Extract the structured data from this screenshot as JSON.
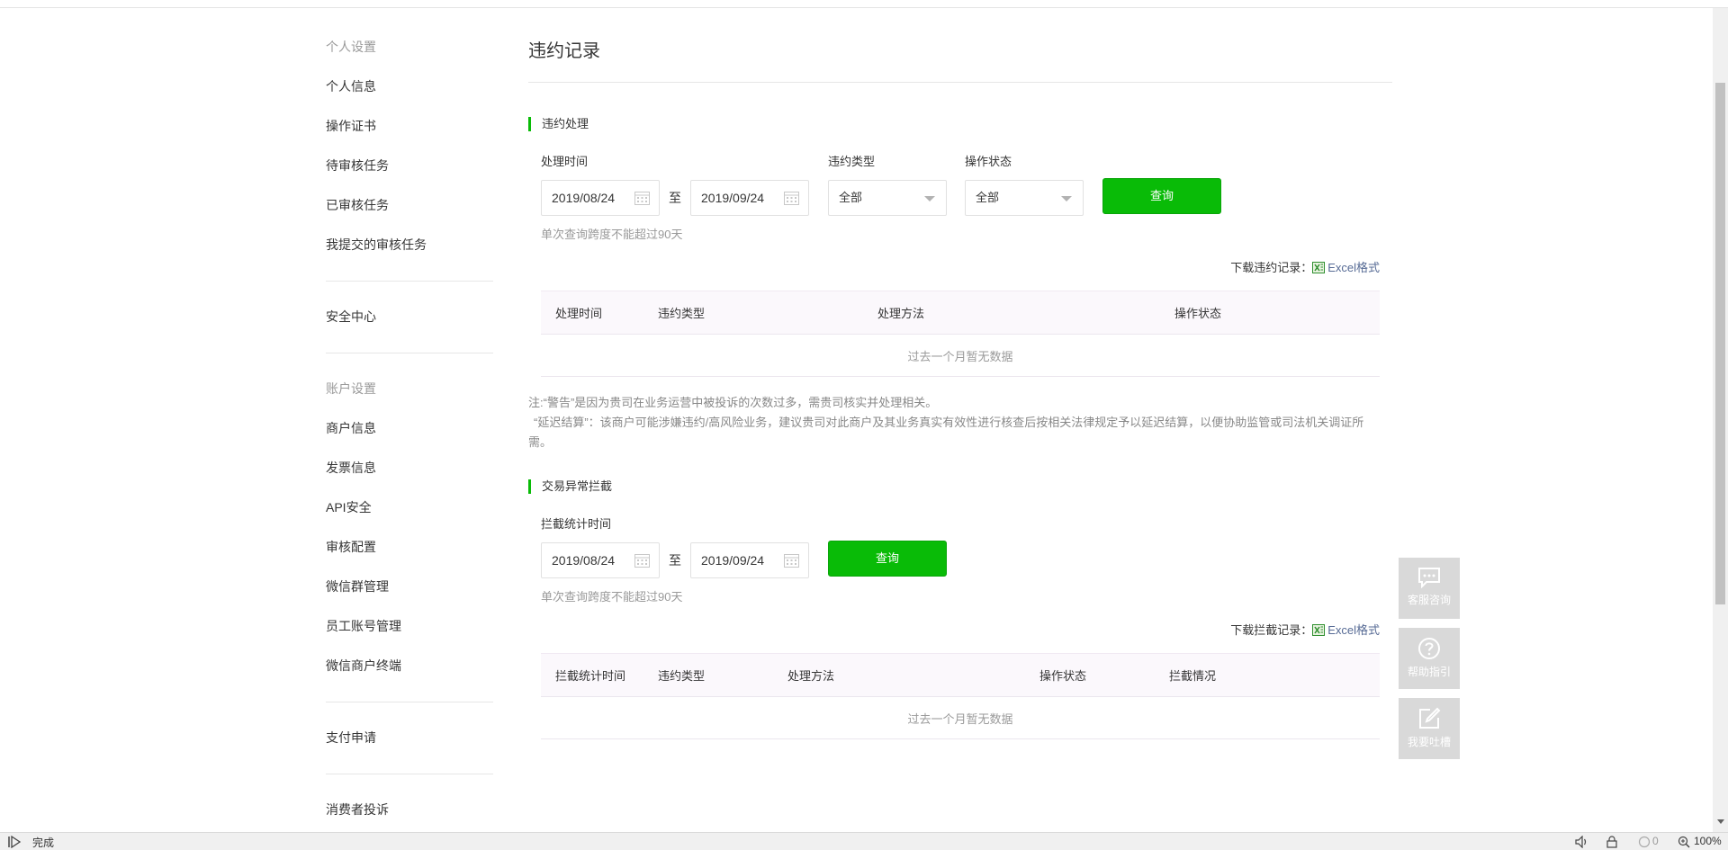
{
  "sidebar": {
    "personal_title": "个人设置",
    "personal_items": [
      "个人信息",
      "操作证书",
      "待审核任务",
      "已审核任务",
      "我提交的审核任务"
    ],
    "security": "安全中心",
    "account_title": "账户设置",
    "account_items": [
      "商户信息",
      "发票信息",
      "API安全",
      "审核配置",
      "微信群管理",
      "员工账号管理",
      "微信商户终端"
    ],
    "pay_apply": "支付申请",
    "complaints": "消费者投诉"
  },
  "main": {
    "title": "违约记录",
    "section1": {
      "title": "违约处理",
      "time_label": "处理时间",
      "start_date": "2019/08/24",
      "to": "至",
      "end_date": "2019/09/24",
      "type_label": "违约类型",
      "type_value": "全部",
      "status_label": "操作状态",
      "status_value": "全部",
      "query": "查询",
      "hint": "单次查询跨度不能超过90天",
      "download_label": "下载违约记录：",
      "download_link": "Excel格式",
      "columns": [
        "处理时间",
        "违约类型",
        "处理方法",
        "操作状态"
      ],
      "empty": "过去一个月暂无数据"
    },
    "note_line1": "注:“警告”是因为贵司在业务运营中被投诉的次数过多，需贵司核实并处理相关。",
    "note_line2": "“延迟结算”：该商户可能涉嫌违约/高风险业务，建议贵司对此商户及其业务真实有效性进行核查后按相关法律规定予以延迟结算，以便协助监管或司法机关调证所需。",
    "section2": {
      "title": "交易异常拦截",
      "time_label": "拦截统计时间",
      "start_date": "2019/08/24",
      "to": "至",
      "end_date": "2019/09/24",
      "query": "查询",
      "hint": "单次查询跨度不能超过90天",
      "download_label": "下载拦截记录：",
      "download_link": "Excel格式",
      "columns": [
        "拦截统计时间",
        "违约类型",
        "处理方法",
        "操作状态",
        "拦截情况"
      ],
      "empty": "过去一个月暂无数据"
    }
  },
  "floating": {
    "consult": "客服咨询",
    "guide": "帮助指引",
    "feedback": "我要吐槽"
  },
  "statusbar": {
    "text": "完成",
    "count": "0",
    "zoom": "100%"
  },
  "colors": {
    "accent": "#09bb07",
    "link": "#576b95"
  }
}
